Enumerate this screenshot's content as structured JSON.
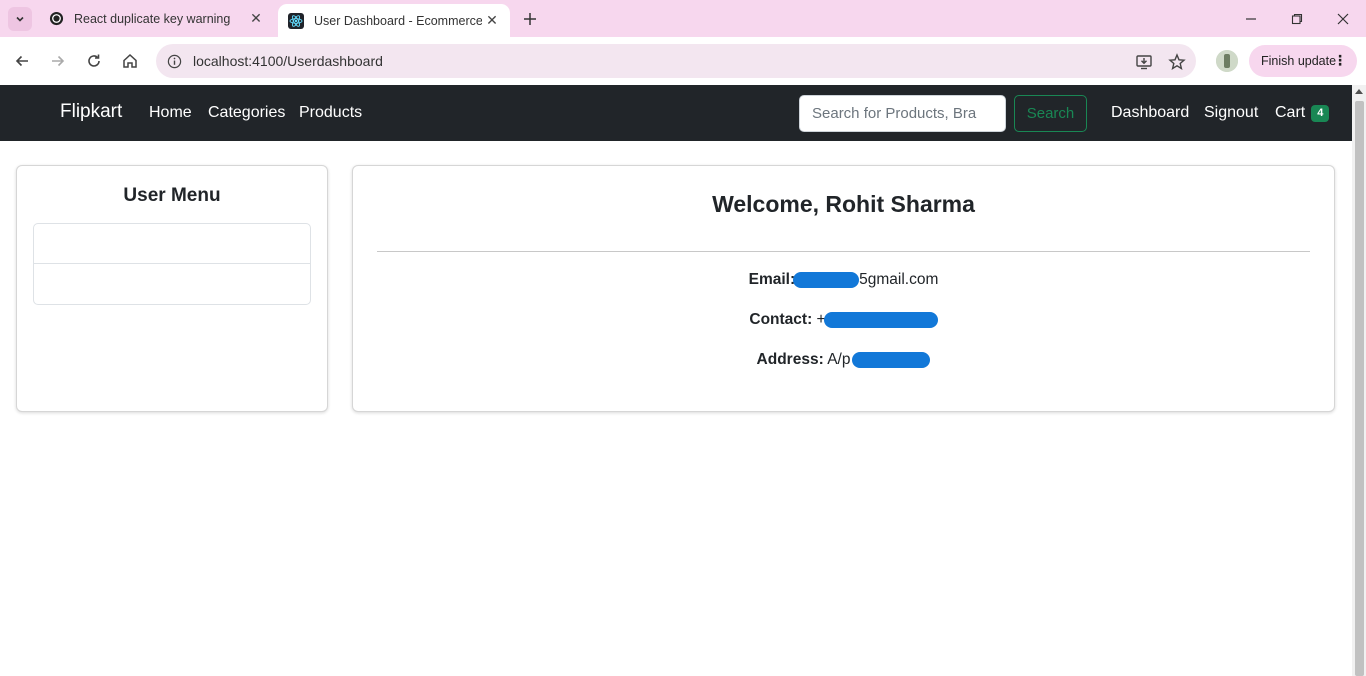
{
  "browser": {
    "tabs": [
      {
        "title": "React duplicate key warning",
        "favicon": "openai-icon",
        "active": false
      },
      {
        "title": "User Dashboard - Ecommerce A",
        "favicon": "react-icon",
        "active": true
      }
    ],
    "url": "localhost:4100/Userdashboard",
    "finish_update_label": "Finish update"
  },
  "navbar": {
    "brand": "Flipkart",
    "links": [
      "Home",
      "Categories",
      "Products"
    ],
    "search_placeholder": "Search for Products, Bra",
    "search_button": "Search",
    "right_links": [
      "Dashboard",
      "Signout"
    ],
    "cart_label": "Cart",
    "cart_count": "4"
  },
  "user_menu": {
    "title": "User Menu",
    "items": [
      "",
      ""
    ]
  },
  "profile": {
    "welcome": "Welcome, Rohit Sharma",
    "email_label": "Email:",
    "email_value_visible": "5gmail.com",
    "contact_label": "Contact:",
    "contact_value_visible": "+",
    "address_label": "Address:",
    "address_value_visible": "A/p"
  },
  "colors": {
    "tabstrip": "#f7d7ee",
    "navbar": "#212529",
    "accent_green": "#198754",
    "redaction": "#1278d8"
  }
}
